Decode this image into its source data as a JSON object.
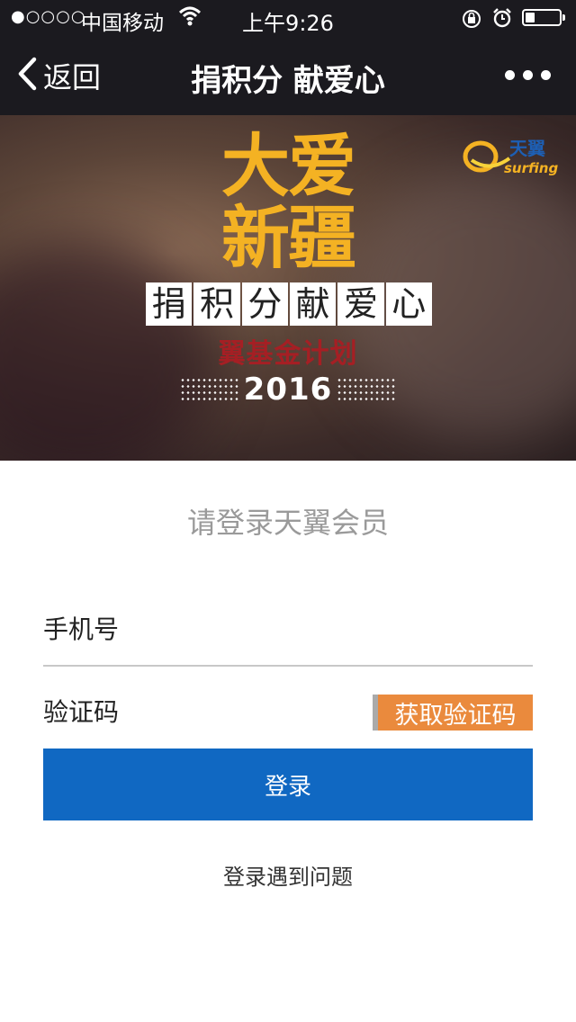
{
  "status_bar": {
    "signal": "●○○○○",
    "carrier": "中国移动",
    "time": "上午9:26"
  },
  "nav": {
    "back_label": "返回",
    "title": "捐积分 献爱心"
  },
  "banner": {
    "line1": "大爱",
    "line2": "新疆",
    "boxes": [
      "捐",
      "积",
      "分",
      "献",
      "爱",
      "心"
    ],
    "plan": "翼基金计划",
    "year": "2016",
    "logo_cn": "天翼",
    "logo_en": "surfing"
  },
  "login_form": {
    "prompt": "请登录天翼会员",
    "phone_label": "手机号",
    "code_label": "验证码",
    "get_code_label": "获取验证码",
    "login_label": "登录",
    "help_label": "登录遇到问题"
  },
  "colors": {
    "topbar": "#1b1a1f",
    "accent_gold": "#f4b223",
    "plan_red": "#a51f24",
    "get_code_orange": "#ea8a3d",
    "login_blue": "#1068c2"
  }
}
